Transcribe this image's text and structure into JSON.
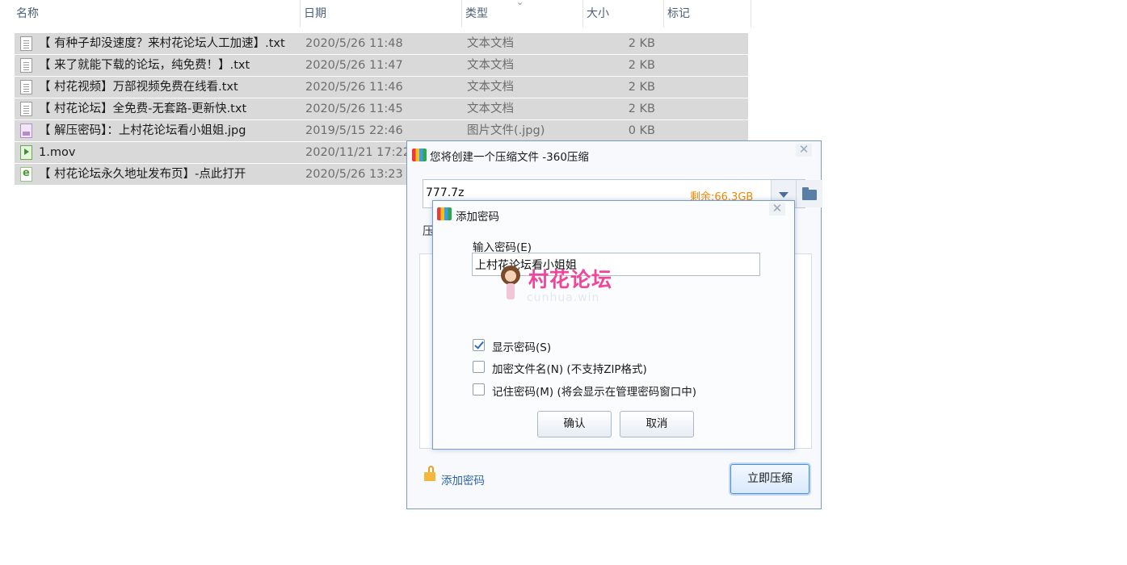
{
  "explorer": {
    "columns": {
      "name": "名称",
      "date": "日期",
      "type": "类型",
      "size": "大小",
      "tags": "标记"
    },
    "files": [
      {
        "name": "【 有种子却没速度？来村花论坛人工加速】.txt",
        "date": "2020/5/26 11:48",
        "type": "文本文档",
        "size": "2 KB",
        "icon": "text-file-icon",
        "selected": true
      },
      {
        "name": "【 来了就能下载的论坛，纯免费！】.txt",
        "date": "2020/5/26 11:47",
        "type": "文本文档",
        "size": "2 KB",
        "icon": "text-file-icon",
        "selected": true
      },
      {
        "name": "【 村花视频】万部视频免费在线看.txt",
        "date": "2020/5/26 11:46",
        "type": "文本文档",
        "size": "2 KB",
        "icon": "text-file-icon",
        "selected": true
      },
      {
        "name": "【 村花论坛】全免费-无套路-更新快.txt",
        "date": "2020/5/26 11:45",
        "type": "文本文档",
        "size": "2 KB",
        "icon": "text-file-icon",
        "selected": true
      },
      {
        "name": "【 解压密码】：上村花论坛看小姐姐.jpg",
        "date": "2019/5/15 22:46",
        "type": "图片文件(.jpg)",
        "size": "0 KB",
        "icon": "image-file-icon",
        "selected": true
      },
      {
        "name": "1.mov",
        "date": "2020/11/21 17:22",
        "type": "",
        "size": "",
        "icon": "video-file-icon",
        "selected": true
      },
      {
        "name": "【 村花论坛永久地址发布页】-点此打开",
        "date": "2020/5/26 13:23",
        "type": "",
        "size": "",
        "icon": "url-file-icon",
        "selected": true
      }
    ]
  },
  "compress_dialog": {
    "title": "您将创建一个压缩文件 -360压缩",
    "path_value": "777.7z",
    "free_space": "剩余:66.3GB",
    "partial_label": "压",
    "add_password_link": "添加密码",
    "compress_button": "立即压缩",
    "close_glyph": "✕"
  },
  "password_dialog": {
    "title": "添加密码",
    "input_label": "输入密码(E)",
    "password_value": "上村花论坛看小姐姐",
    "watermark_main": "村花论坛",
    "watermark_sub": "cunhua.win",
    "show_password": {
      "label": "显示密码(S)",
      "checked": true
    },
    "encrypt_names": {
      "label": "加密文件名(N) (不支持ZIP格式)",
      "checked": false
    },
    "remember": {
      "label": "记住密码(M) (将会显示在管理密码窗口中)",
      "checked": false
    },
    "ok_button": "确认",
    "cancel_button": "取消",
    "close_glyph": "✕"
  },
  "colors": {
    "selection": "#d9d9d9",
    "dialog_border": "#7a9cc4",
    "free_space": "#f08a00",
    "link": "#2a63b0",
    "watermark": "#f2459a"
  }
}
